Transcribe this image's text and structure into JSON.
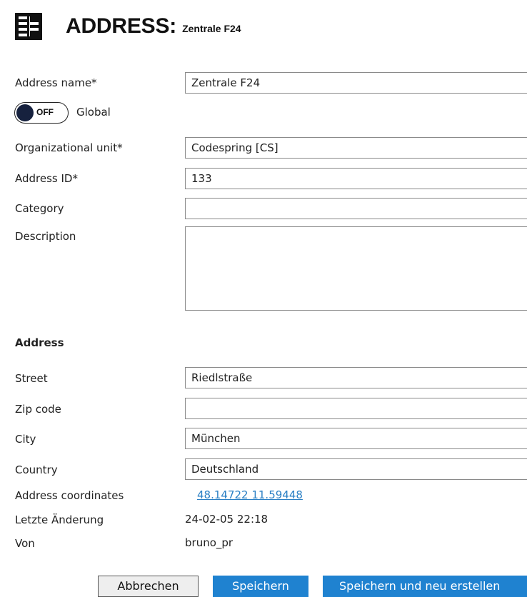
{
  "header": {
    "icon": "address-book-icon",
    "title": "ADDRESS:",
    "subtitle": "Zentrale F24"
  },
  "form": {
    "address_name": {
      "label": "Address name*",
      "value": "Zentrale F24"
    },
    "global": {
      "state": "OFF",
      "label": "Global"
    },
    "org_unit": {
      "label": "Organizational unit*",
      "value": "Codespring [CS]"
    },
    "address_id": {
      "label": "Address ID*",
      "value": "133"
    },
    "category": {
      "label": "Category",
      "value": ""
    },
    "description": {
      "label": "Description",
      "value": ""
    }
  },
  "address": {
    "section_title": "Address",
    "street": {
      "label": "Street",
      "value": "Riedlstraße"
    },
    "zip": {
      "label": "Zip code",
      "value": ""
    },
    "city": {
      "label": "City",
      "value": "München"
    },
    "country": {
      "label": "Country",
      "value": "Deutschland"
    },
    "coordinates": {
      "label": "Address coordinates",
      "value": "48.14722 11.59448"
    },
    "last_change": {
      "label": "Letzte Änderung",
      "value": "24-02-05 22:18"
    },
    "by": {
      "label": "Von",
      "value": "bruno_pr"
    }
  },
  "buttons": {
    "cancel": "Abbrechen",
    "save": "Speichern",
    "save_new": "Speichern und neu erstellen"
  },
  "colors": {
    "primary_button": "#1f82d0",
    "link": "#2a7fc4",
    "toggle_knob": "#16213e"
  }
}
